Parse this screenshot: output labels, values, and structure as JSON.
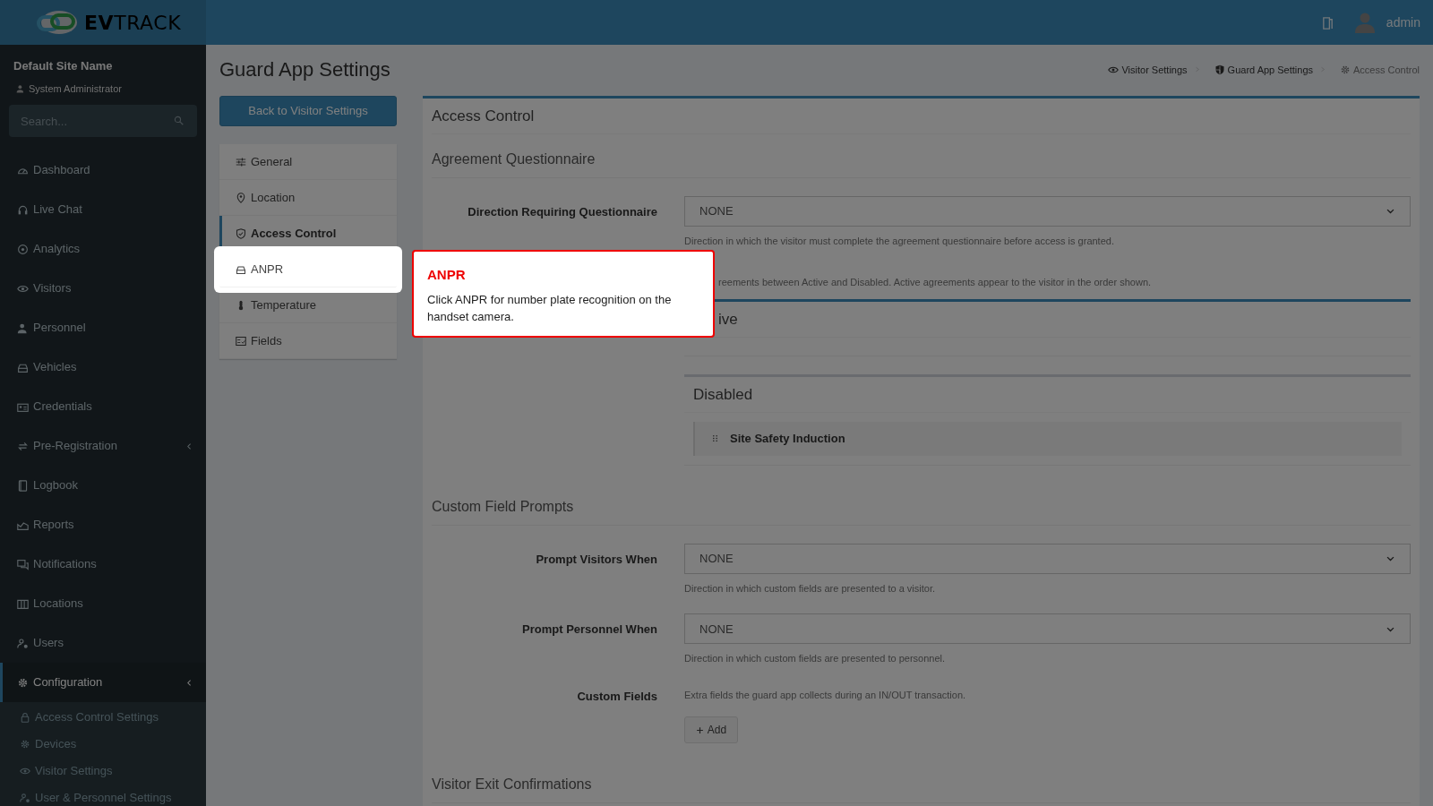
{
  "header": {
    "logo": "**EV**TRACK",
    "user": "admin"
  },
  "sidebar": {
    "site_name": "Default Site Name",
    "role": "System Administrator",
    "search": {
      "placeholder": "Search..."
    },
    "items": [
      {
        "label": "Dashboard",
        "selected": false,
        "expandable": false
      },
      {
        "label": "Live Chat",
        "selected": false,
        "expandable": false
      },
      {
        "label": "Analytics",
        "selected": false,
        "expandable": false
      },
      {
        "label": "Visitors",
        "selected": false,
        "expandable": false
      },
      {
        "label": "Personnel",
        "selected": false,
        "expandable": false
      },
      {
        "label": "Vehicles",
        "selected": false,
        "expandable": false
      },
      {
        "label": "Credentials",
        "selected": false,
        "expandable": false
      },
      {
        "label": "Pre-Registration",
        "selected": false,
        "expandable": true
      },
      {
        "label": "Logbook",
        "selected": false,
        "expandable": false
      },
      {
        "label": "Reports",
        "selected": false,
        "expandable": false
      },
      {
        "label": "Notifications",
        "selected": false,
        "expandable": false
      },
      {
        "label": "Locations",
        "selected": false,
        "expandable": false
      },
      {
        "label": "Users",
        "selected": false,
        "expandable": false
      },
      {
        "label": "Configuration",
        "selected": true,
        "expandable": true,
        "children": [
          {
            "label": "Access Control Settings"
          },
          {
            "label": "Devices"
          },
          {
            "label": "Visitor Settings"
          },
          {
            "label": "User & Personnel Settings"
          }
        ]
      }
    ]
  },
  "page": {
    "title": "Guard App Settings",
    "back_button": "Back to Visitor Settings",
    "breadcrumbs": [
      {
        "label": "Visitor Settings",
        "current": false
      },
      {
        "label": "Guard App Settings",
        "current": false
      },
      {
        "label": "Access Control",
        "current": true
      }
    ],
    "settings_nav": [
      {
        "label": "General",
        "selected": false,
        "spotlight": false
      },
      {
        "label": "Location",
        "selected": false,
        "spotlight": false
      },
      {
        "label": "Access Control",
        "selected": true,
        "spotlight": false
      },
      {
        "label": "ANPR",
        "selected": false,
        "spotlight": true
      },
      {
        "label": "Temperature",
        "selected": false,
        "spotlight": false
      },
      {
        "label": "Fields",
        "selected": false,
        "spotlight": false
      }
    ],
    "card": {
      "title": "Access Control",
      "sections": [
        {
          "heading": "Agreement Questionnaire",
          "rows": [
            {
              "kind": "select",
              "label": "Direction Requiring Questionnaire",
              "value": "NONE",
              "help": "Direction in which the visitor must complete the agreement questionnaire before access is granted."
            },
            {
              "kind": "agreements",
              "help": "reements between Active and Disabled. Active agreements appear to the visitor in the order shown.",
              "panels": [
                {
                  "title": "ive"
                },
                {
                  "title": "Disabled",
                  "items": [
                    "Site Safety Induction"
                  ]
                }
              ]
            }
          ]
        },
        {
          "heading": "Custom Field Prompts",
          "rows": [
            {
              "kind": "select",
              "label": "Prompt Visitors When",
              "value": "NONE",
              "help": "Direction in which custom fields are presented to a visitor."
            },
            {
              "kind": "select",
              "label": "Prompt Personnel When",
              "value": "NONE",
              "help": "Direction in which custom fields are presented to personnel."
            },
            {
              "kind": "add",
              "label": "Custom Fields",
              "help": "Extra fields the guard app collects during an IN/OUT transaction.",
              "button": "Add"
            }
          ]
        },
        {
          "heading": "Visitor Exit Confirmations"
        }
      ]
    }
  },
  "tour": {
    "title": "ANPR",
    "text": "Click ANPR for number plate recognition on the handset camera."
  }
}
